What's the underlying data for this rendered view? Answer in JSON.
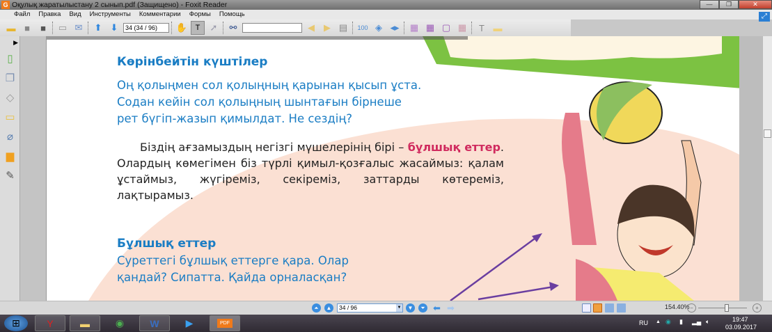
{
  "window": {
    "title": "Оқулық жаратылыстану 2 сынып.pdf (Защищено) - Foxit Reader",
    "logo": "G",
    "minimize": "—",
    "maximize": "❐",
    "close": "✕"
  },
  "menu": [
    "Файл",
    "Правка",
    "Вид",
    "Инструменты",
    "Комментарии",
    "Формы",
    "Помощь"
  ],
  "toolbar": {
    "page_field": "34 (34 / 96)",
    "find_value": ""
  },
  "page": {
    "heading1": "Көрінбейтін күштілер",
    "intro_lines": [
      "Оң қолыңмен сол қолыңның қарынан қысып ұста.",
      "Содан кейін сол қолыңның шынтағын бірнеше",
      "рет бүгіп-жазып қимылдат. Не сездің?"
    ],
    "body_before": "Біздің ағзамыздың негізгі мүшелерінің бірі –",
    "body_highlight": "бұлшық еттер",
    "body_after": ". Олардың көмегімен біз түрлі қимыл-қозғалыс жасаймыз: қалам ұстаймыз, жүгіреміз, секіреміз, заттарды көтереміз, лақтырамыз.",
    "heading2": "Бұлшық еттер",
    "task_lines": [
      "Суреттегі бұлшық еттерге қара. Олар",
      "қандай? Сипатта. Қайда орналасқан?"
    ],
    "colors": {
      "blue": "#1a7dc4",
      "highlight": "#d02a5e",
      "green": "#7cc242",
      "peach": "#fbe0d3"
    }
  },
  "status": {
    "page_select": "34 / 96",
    "zoom": "154.40%",
    "zoom_level_fraction": 0.6
  },
  "tray": {
    "lang": "RU",
    "time": "19:47",
    "date": "03.09.2017"
  },
  "taskbar": {
    "pdf_label": "PDF"
  }
}
